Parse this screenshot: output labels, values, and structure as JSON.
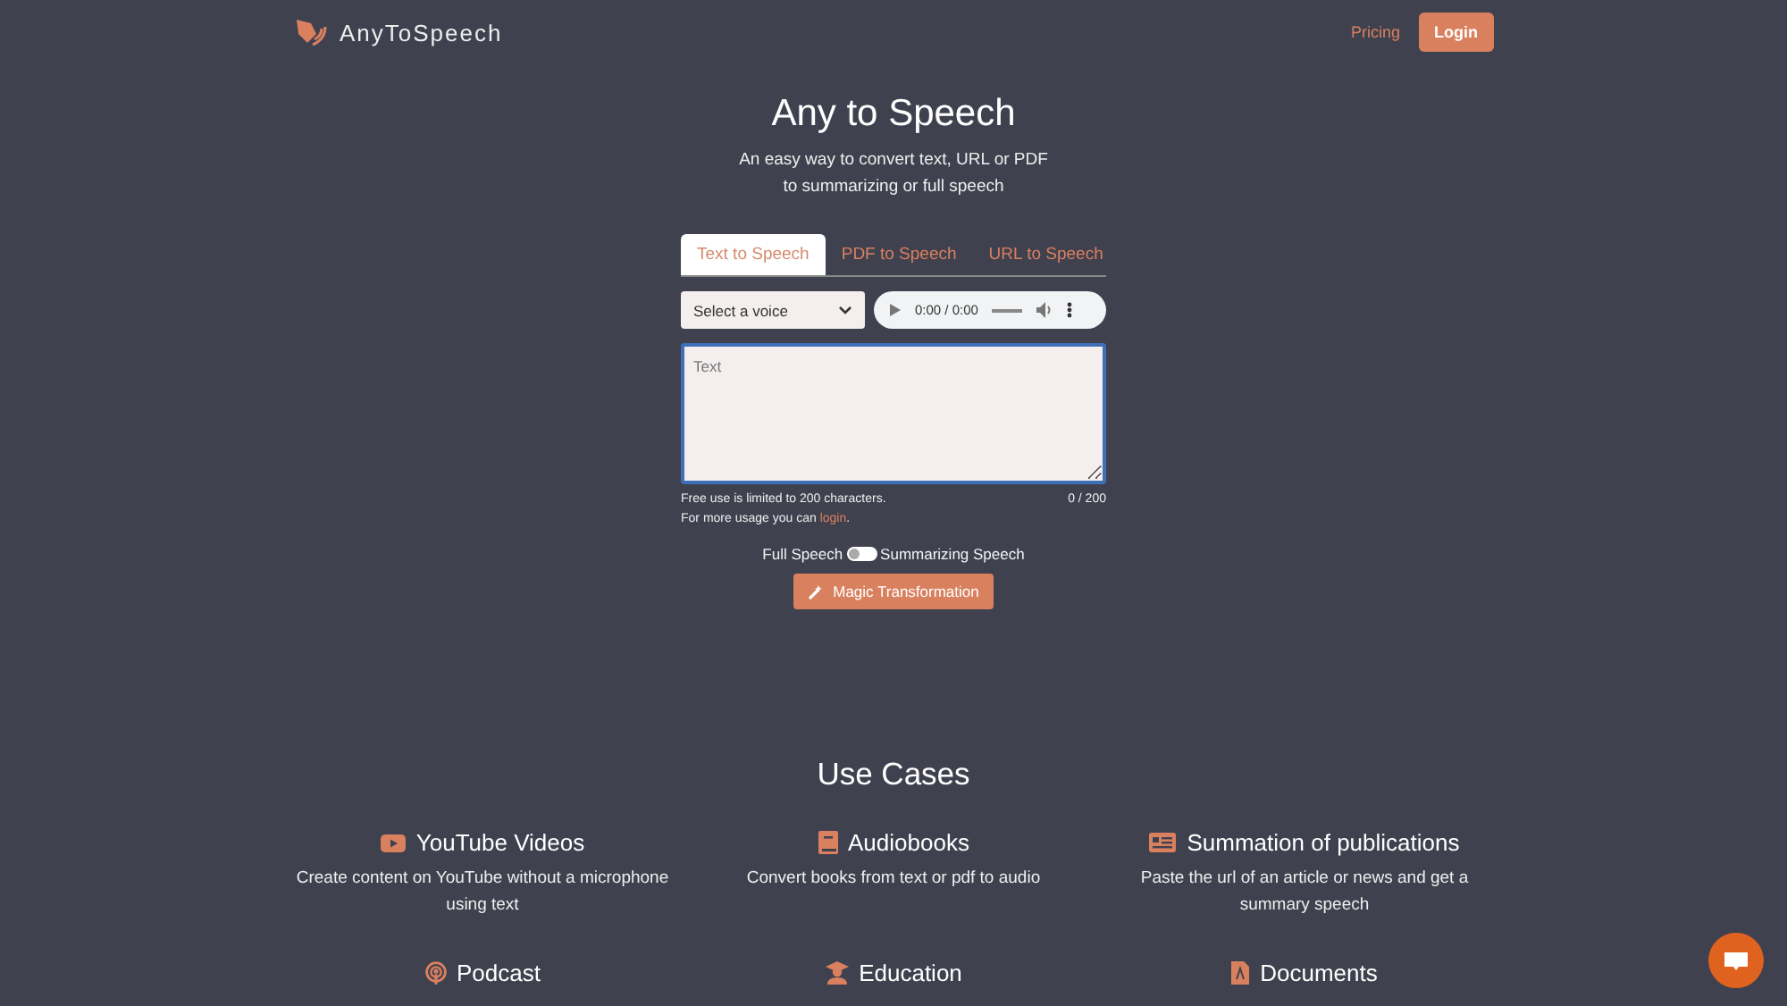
{
  "header": {
    "brand": "AnyToSpeech",
    "nav": [
      {
        "label": "Pricing",
        "kind": "link"
      },
      {
        "label": "Login",
        "kind": "button"
      }
    ]
  },
  "hero": {
    "title": "Any to Speech",
    "subtitle_lines": [
      "An easy way to convert text, URL or PDF",
      "to summarizing or full speech"
    ]
  },
  "tabs": [
    {
      "label": "Text to Speech",
      "selected": true
    },
    {
      "label": "PDF to Speech",
      "selected": false
    },
    {
      "label": "URL to Speech",
      "selected": false
    }
  ],
  "voice_select": {
    "placeholder": "Select a voice"
  },
  "audio_player": {
    "time": "0:00 / 0:00"
  },
  "text_input": {
    "placeholder": "Text",
    "counter": "0 / 200"
  },
  "notes": {
    "limit": "Free use is limited to 200 characters.",
    "more": "For more usage you can **login**."
  },
  "mode_toggle": {
    "left_label": "Full Speech",
    "right_label": "Summarizing Speech",
    "on": false
  },
  "action_button": "Magic Transformation",
  "use_cases": {
    "title": "Use Cases",
    "items": [
      {
        "title": "YouTube Videos",
        "description": "Create content on YouTube without a microphone using text"
      },
      {
        "title": "Audiobooks",
        "description": "Convert books from text or pdf to audio"
      },
      {
        "title": "Summation of publications",
        "description": "Paste the url of an article or news and get a summary speech"
      },
      {
        "title": "Podcast"
      },
      {
        "title": "Education"
      },
      {
        "title": "Documents"
      }
    ]
  }
}
